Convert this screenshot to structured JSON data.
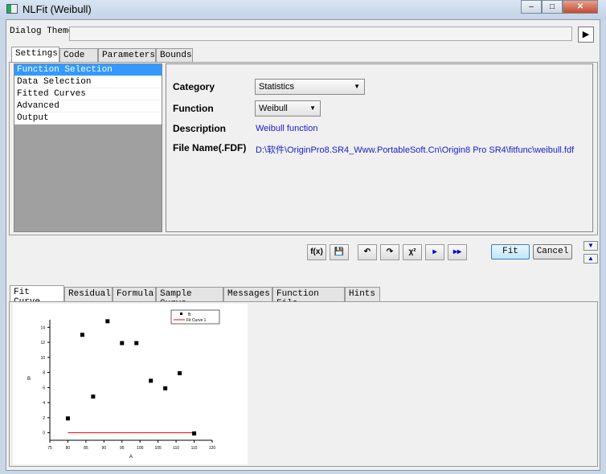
{
  "window": {
    "title": "NLFit (Weibull)",
    "min": "–",
    "max": "□",
    "close": "✕"
  },
  "theme": {
    "label": "Dialog Theme",
    "value": "",
    "button": "▶"
  },
  "top_tabs": [
    "Settings",
    "Code",
    "Parameters",
    "Bounds"
  ],
  "sidebar": [
    "Function Selection",
    "Data Selection",
    "Fitted Curves",
    "Advanced",
    "Output"
  ],
  "settings": {
    "category_label": "Category",
    "category": "Statistics",
    "function_label": "Function",
    "function": "Weibull",
    "description_label": "Description",
    "description": "Weibull function",
    "file_label": "File Name(.FDF)",
    "file": "D:\\软件\\OriginPro8.SR4_Www.PortableSoft.Cn\\Origin8 Pro SR4\\fitfunc\\weibull.fdf"
  },
  "toolbar": {
    "icons": [
      "f(x)",
      "💾",
      "↶",
      "↷",
      "χ²",
      "▸",
      "▸▸"
    ],
    "fit": "Fit",
    "cancel": "Cancel",
    "down": "▼",
    "up": "▲"
  },
  "bottom_tabs": [
    "Fit Curve",
    "Residual",
    "Formula",
    "Sample Curve",
    "Messages",
    "Function File",
    "Hints"
  ],
  "chart_data": {
    "type": "scatter",
    "xlabel": "A",
    "ylabel": "B",
    "xlim": [
      75,
      120
    ],
    "ylim": [
      -1,
      15
    ],
    "xticks": [
      "75",
      "80",
      "85",
      "90",
      "95",
      "100",
      "105",
      "110",
      "115",
      "120"
    ],
    "yticks": [
      "0",
      "2",
      "4",
      "6",
      "8",
      "10",
      "12",
      "14"
    ],
    "legend": [
      "B",
      "Fit Curve 1"
    ],
    "legend_position": "top-right",
    "series": [
      {
        "name": "B",
        "x": [
          80,
          84,
          87,
          91,
          95,
          99,
          103,
          107,
          111,
          115
        ],
        "y": [
          1.9,
          13,
          4.8,
          14.8,
          11.9,
          11.9,
          6.9,
          5.9,
          7.9,
          -0.1
        ]
      },
      {
        "name": "Fit Curve 1",
        "x": [
          80,
          115
        ],
        "y": [
          0,
          0
        ],
        "color": "#ff0000"
      }
    ]
  }
}
